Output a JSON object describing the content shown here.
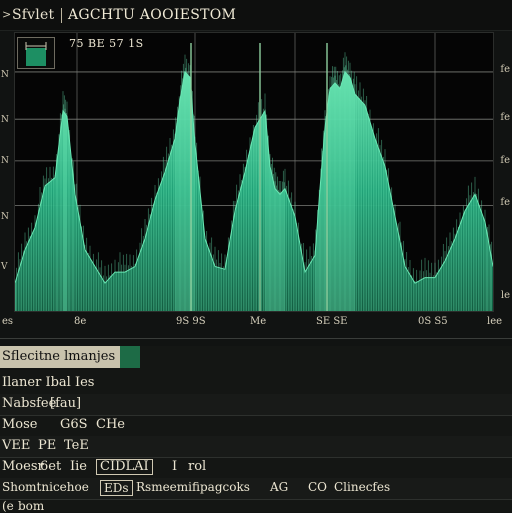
{
  "app": {
    "arrow": ">",
    "name": "Sfvlet",
    "title": "AGCHTU AOOIESTOM"
  },
  "plot_label": "75 BE 57 1S",
  "left_ticks": [
    "N",
    "N",
    "N",
    "N",
    "V"
  ],
  "right_ticks": [
    "fe",
    "fe",
    "fe",
    "fe",
    "le"
  ],
  "x_ticks": [
    "es",
    "8e",
    "9S 9S",
    "Me",
    "SE SE",
    "0S S5",
    "lee"
  ],
  "panel": {
    "header": "Sflecitne lmanjes",
    "rows": [
      {
        "a": "Ilaner Ibal Ies"
      },
      {
        "a": "Nabsfee",
        "b": "fau"
      },
      {
        "a": "Mose",
        "b": "G6S",
        "c": "CHe"
      },
      {
        "a": "VEE",
        "b": "PE",
        "c": "TeE"
      },
      {
        "a": "Moesr",
        "b": "6et",
        "c": "Iie",
        "d": "CIDLAI",
        "e": "I",
        "f": "rol"
      },
      {
        "a": "Shomtnicehoe",
        "b": "EDs",
        "c": "Rsmeemifipagcoks",
        "d": "AG",
        "e": "CO",
        "f": "Clinecfes"
      },
      {
        "a": "(e",
        "b": "bom"
      }
    ]
  },
  "chart_data": {
    "type": "area",
    "x": [
      0,
      10,
      20,
      30,
      40,
      48,
      52,
      60,
      70,
      80,
      90,
      100,
      110,
      120,
      130,
      140,
      150,
      160,
      165,
      170,
      175,
      180,
      190,
      200,
      210,
      220,
      230,
      240,
      250,
      255,
      260,
      265,
      270,
      280,
      290,
      300,
      305,
      310,
      315,
      320,
      325,
      330,
      335,
      340,
      350,
      360,
      370,
      380,
      390,
      400,
      410,
      420,
      430,
      440,
      450,
      460,
      470,
      478
    ],
    "series": [
      {
        "values": [
          0.1,
          0.22,
          0.3,
          0.45,
          0.48,
          0.72,
          0.7,
          0.42,
          0.22,
          0.16,
          0.1,
          0.14,
          0.14,
          0.16,
          0.26,
          0.4,
          0.5,
          0.62,
          0.76,
          0.86,
          0.84,
          0.6,
          0.26,
          0.16,
          0.15,
          0.36,
          0.5,
          0.66,
          0.72,
          0.52,
          0.44,
          0.42,
          0.44,
          0.34,
          0.14,
          0.2,
          0.44,
          0.66,
          0.8,
          0.82,
          0.8,
          0.86,
          0.84,
          0.78,
          0.74,
          0.62,
          0.52,
          0.34,
          0.16,
          0.1,
          0.12,
          0.12,
          0.18,
          0.26,
          0.36,
          0.42,
          0.32,
          0.16
        ]
      }
    ],
    "colors": {
      "fill": "#1fa67a",
      "highlight": "#69e8b4",
      "gridline": "#7b7d78",
      "vline": "#8ecf9f"
    }
  }
}
